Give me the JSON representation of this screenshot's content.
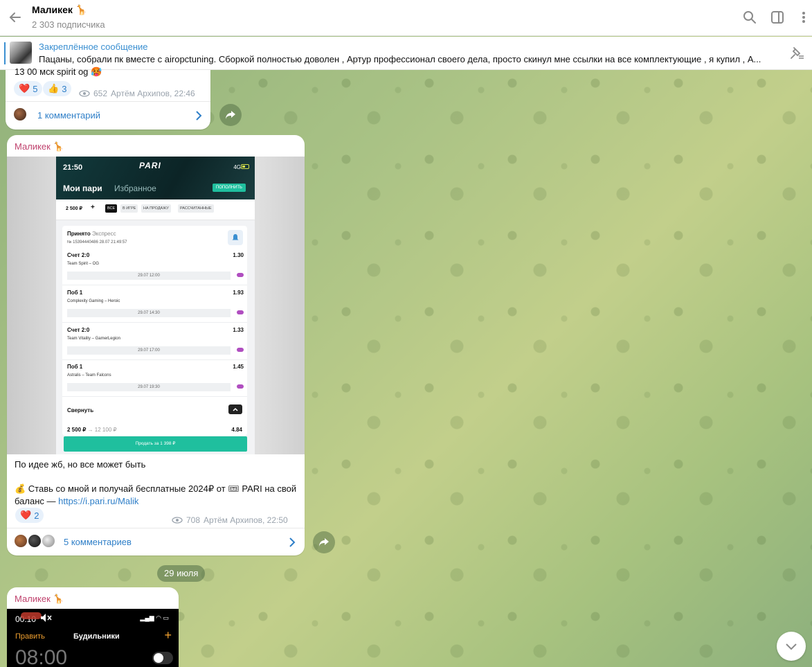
{
  "header": {
    "title": "Маликек 🦒",
    "subscribers": "2 303 подписчика",
    "icons": [
      "back-arrow-icon",
      "search-icon",
      "sidebar-toggle-icon",
      "more-vert-icon"
    ]
  },
  "pinned": {
    "title": "Закреплённое сообщение",
    "text": "Пацаны, собрали пк вместе с airopctuning. Сборкой полностью доволен , Артур профессионал своего дела, просто скинул мне ссылки на все комплектующие , я купил , А..."
  },
  "post1": {
    "text_cut": "13 00 мск spirit og 🥵",
    "reactions": [
      {
        "emoji": "❤️",
        "count": "5"
      },
      {
        "emoji": "👍",
        "count": "3"
      }
    ],
    "views": "652",
    "author_time": "Артём Архипов, 22:46",
    "comments": "1 комментарий"
  },
  "post2": {
    "author": "Маликек 🦒",
    "phone": {
      "time": "21:50",
      "logo": "PARI",
      "network": "4G",
      "tab_active": "Мои пари",
      "tab_inactive": "Избранное",
      "topup": "ПОПОЛНИТЬ",
      "amount": "2 500 ₽",
      "plus": "+",
      "filters": [
        "ВСЕ",
        "В ИГРЕ",
        "НА ПРОДАЖУ",
        "РАССЧИТАННЫЕ"
      ],
      "status": "Принято",
      "status_type": "Экспресс",
      "ticket": "№ 15394440486   28.07   21:49:57",
      "bets": [
        {
          "name": "Счет 2:0",
          "coef": "1.30",
          "teams": "Team Spirit – OG",
          "date": "29.07 12:00"
        },
        {
          "name": "Поб 1",
          "coef": "1.93",
          "teams": "Complexity Gaming – Heroic",
          "date": "29.07 14:30"
        },
        {
          "name": "Счет 2:0",
          "coef": "1.33",
          "teams": "Team Vitality – GamerLegion",
          "date": "29.07 17:00"
        },
        {
          "name": "Поб 1",
          "coef": "1.45",
          "teams": "Astralis – Team Falcons",
          "date": "29.07 19:30"
        }
      ],
      "collapse": "Свернуть",
      "stake": "2 500 ₽",
      "payout": "→ 12 100 ₽",
      "total_coef": "4.84",
      "sell": "Продать за 1 398 ₽"
    },
    "text1": "По идее жб, но все может быть",
    "text2": "💰 Ставь со мной и получай бесплатные 2024₽ от 🎟 PARI на свой баланс — ",
    "link": "https://i.pari.ru/Malik",
    "reactions": [
      {
        "emoji": "❤️",
        "count": "2"
      }
    ],
    "views": "708",
    "author_time": "Артём Архипов, 22:50",
    "comments": "5 комментариев"
  },
  "date_separator": "29 июля",
  "post3": {
    "author": "Маликек 🦒",
    "alarm": {
      "time": "00:10",
      "edit": "Править",
      "title": "Будильники",
      "plus": "+",
      "big_time": "08:00"
    }
  },
  "colors": {
    "accent": "#2f7fc8",
    "author": "#c0436e",
    "pari_green": "#1fbf9e"
  }
}
